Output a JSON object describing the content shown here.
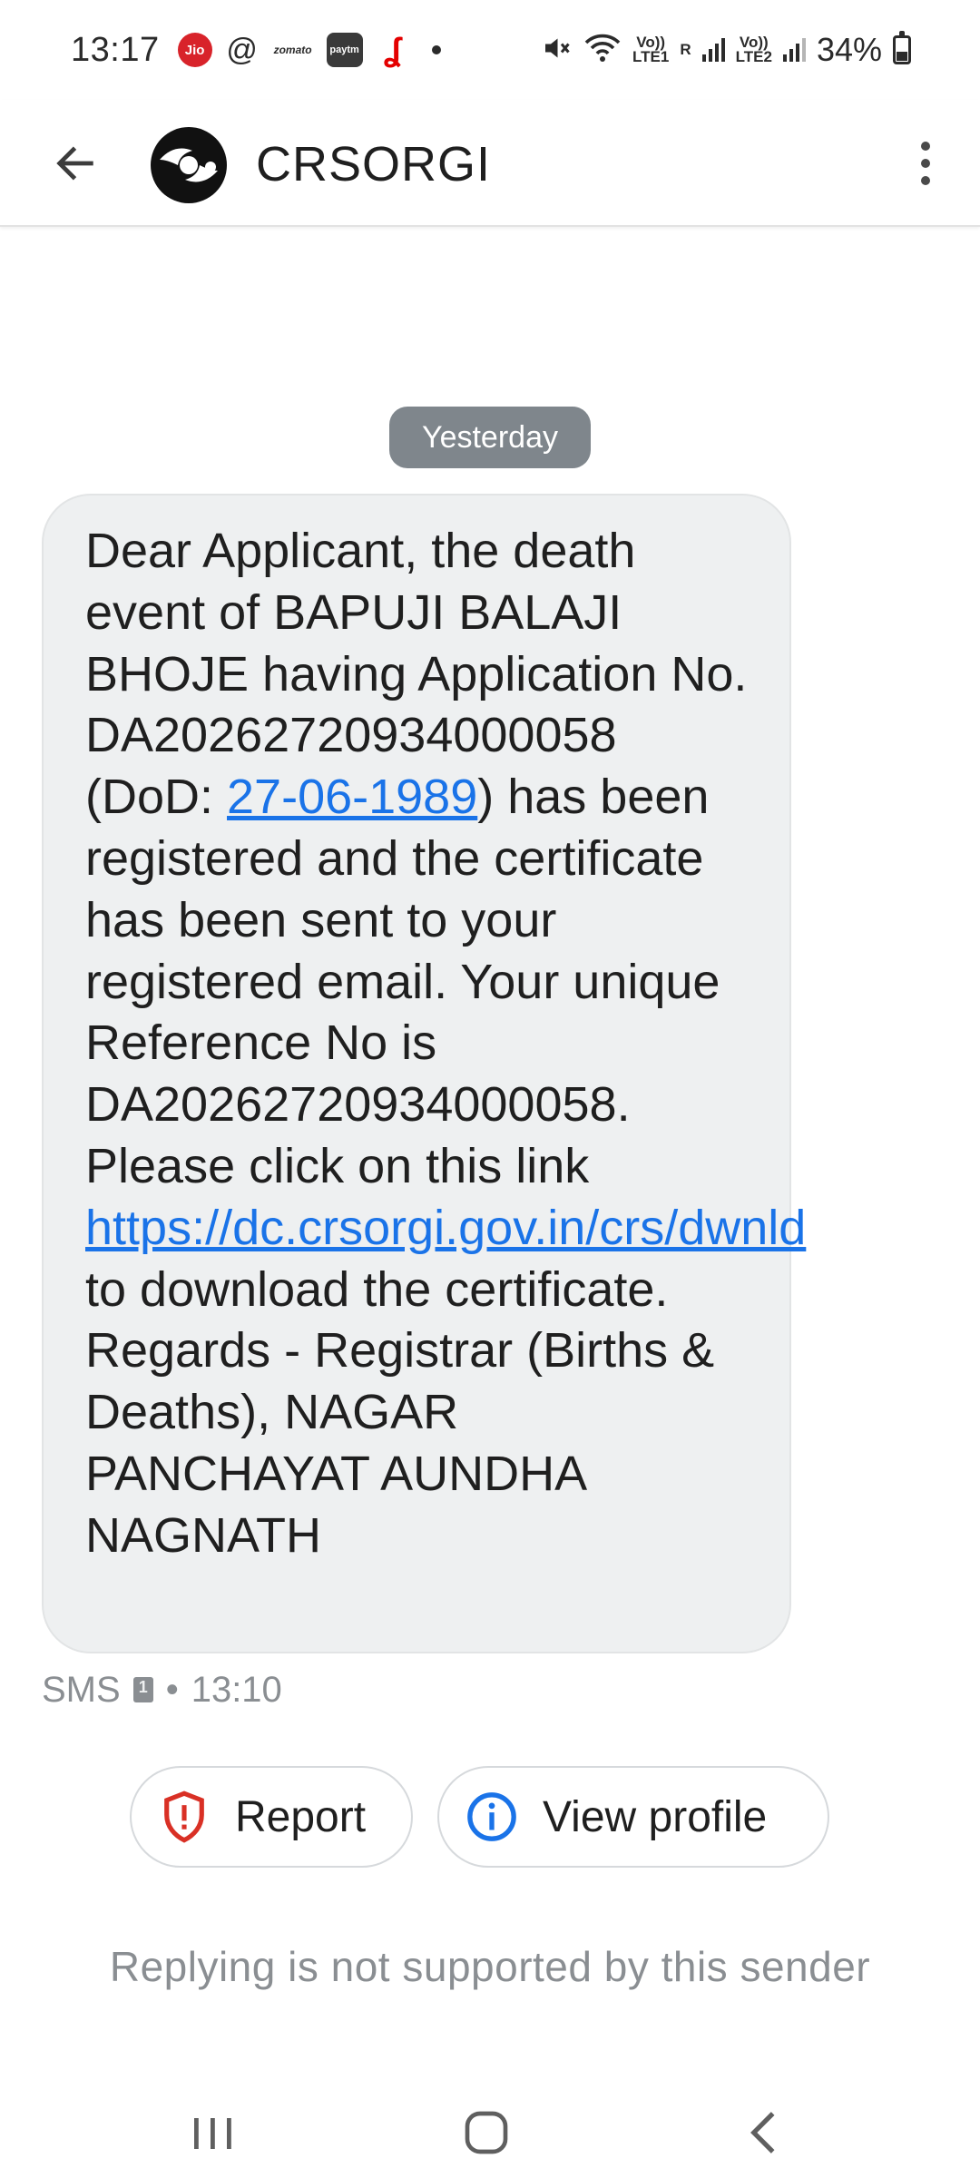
{
  "status_bar": {
    "time": "13:17",
    "app_icons": [
      "jio-icon",
      "threads-icon",
      "zomato-icon",
      "paytm-icon",
      "airtel-icon"
    ],
    "jio_label": "Jio",
    "zomato_label": "zomato",
    "paytm_label": "paytm",
    "sim1_label_top": "Vo))",
    "sim1_label_bottom": "LTE1",
    "sim1_roaming": "R",
    "sim2_label_top": "Vo))",
    "sim2_label_bottom": "LTE2",
    "battery": "34%"
  },
  "app_bar": {
    "sender_name": "CRSORGI"
  },
  "conversation": {
    "date_chip": "Yesterday",
    "message": {
      "text_before_date": "Dear Applicant, the death event of BAPUJI BALAJI BHOJE having Application No. DA20262720934000058 (DoD: ",
      "date_link": "27-06-1989",
      "text_after_date": ") has been registered and the certificate has been sent to your registered email. Your unique Reference No is DA20262720934000058. Please click on this link ",
      "url_link": "https://dc.crsorgi.gov.in/crs/dwnld",
      "text_end": " to download the certificate. Regards - Registrar (Births & Deaths), NAGAR PANCHAYAT AUNDHA NAGNATH"
    },
    "meta": {
      "type": "SMS",
      "separator": "•",
      "time": "13:10"
    }
  },
  "actions": {
    "report_label": "Report",
    "view_profile_label": "View profile"
  },
  "footer": {
    "reply_note": "Replying is not supported by this sender"
  },
  "colors": {
    "link": "#1a73e8",
    "report_icon": "#d93025",
    "profile_icon": "#1a73e8",
    "bubble_bg": "#eef0f1",
    "date_chip_bg": "#7f868c"
  }
}
